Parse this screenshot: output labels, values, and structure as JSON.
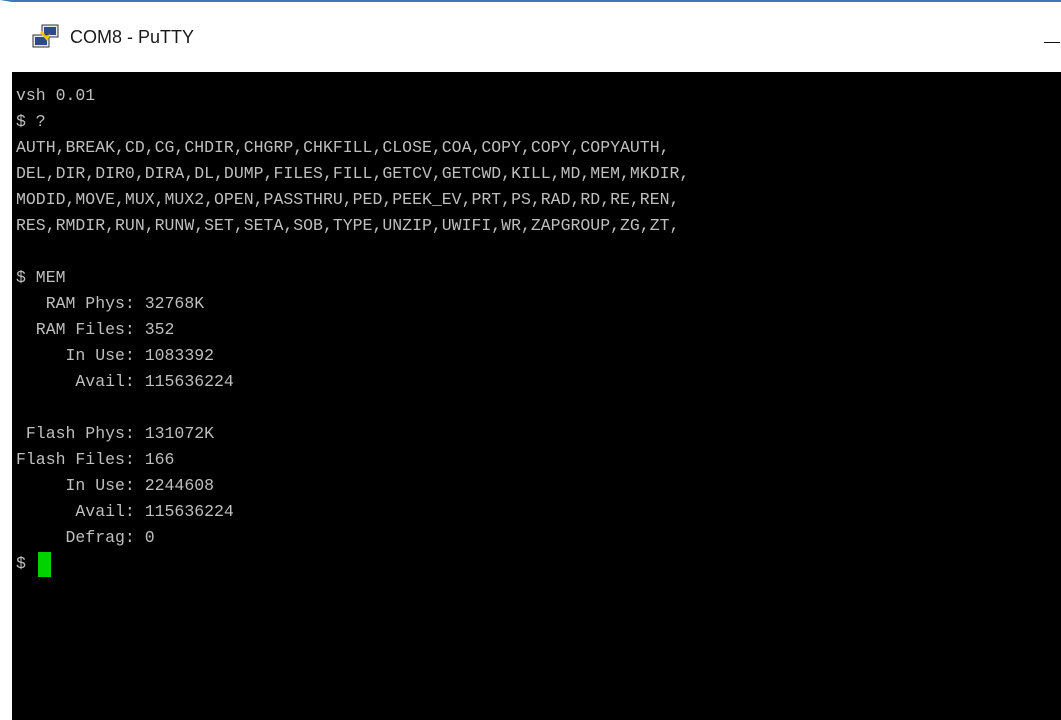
{
  "window": {
    "title": "COM8 - PuTTY",
    "icon": "putty-icon"
  },
  "colors": {
    "terminal_background": "#000000",
    "terminal_text": "#bfbfbf",
    "cursor": "#00d400",
    "title_bar_border": "#3a78c2"
  },
  "terminal": {
    "lines": [
      "vsh 0.01",
      "$ ?",
      "AUTH,BREAK,CD,CG,CHDIR,CHGRP,CHKFILL,CLOSE,COA,COPY,COPY,COPYAUTH,",
      "DEL,DIR,DIR0,DIRA,DL,DUMP,FILES,FILL,GETCV,GETCWD,KILL,MD,MEM,MKDIR,",
      "MODID,MOVE,MUX,MUX2,OPEN,PASSTHRU,PED,PEEK_EV,PRT,PS,RAD,RD,RE,REN,",
      "RES,RMDIR,RUN,RUNW,SET,SETA,SOB,TYPE,UNZIP,UWIFI,WR,ZAPGROUP,ZG,ZT,",
      "",
      "$ MEM",
      "   RAM Phys: 32768K",
      "  RAM Files: 352",
      "     In Use: 1083392",
      "      Avail: 115636224",
      "",
      " Flash Phys: 131072K",
      "Flash Files: 166",
      "     In Use: 2244608",
      "      Avail: 115636224",
      "     Defrag: 0"
    ],
    "prompt": "$"
  }
}
